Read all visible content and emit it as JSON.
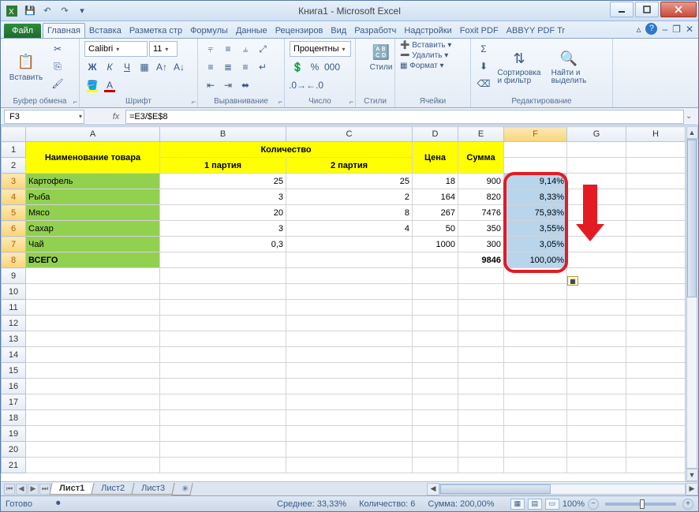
{
  "titlebar": {
    "title": "Книга1 - Microsoft Excel"
  },
  "qat": {
    "save": "💾",
    "undo": "↶",
    "redo": "↷"
  },
  "ribbon": {
    "file": "Файл",
    "tabs": [
      "Главная",
      "Вставка",
      "Разметка стр",
      "Формулы",
      "Данные",
      "Рецензиров",
      "Вид",
      "Разработч",
      "Надстройки",
      "Foxit PDF",
      "ABBYY PDF Tr"
    ],
    "groups": {
      "clipboard": {
        "label": "Буфер обмена",
        "paste": "Вставить"
      },
      "font": {
        "label": "Шрифт",
        "name": "Calibri",
        "size": "11",
        "bold": "Ж",
        "italic": "К",
        "underline": "Ч"
      },
      "align": {
        "label": "Выравнивание"
      },
      "number": {
        "label": "Число",
        "format": "Процентны"
      },
      "styles": {
        "label": "Стили",
        "btn": "Стили"
      },
      "cells": {
        "label": "Ячейки",
        "insert": "Вставить",
        "delete": "Удалить",
        "format": "Формат"
      },
      "editing": {
        "label": "Редактирование",
        "sort": "Сортировка\nи фильтр",
        "find": "Найти и\nвыделить"
      }
    }
  },
  "formula": {
    "cell": "F3",
    "value": "=E3/$E$8"
  },
  "columns": {
    "A": "A",
    "B": "B",
    "C": "C",
    "D": "D",
    "E": "E",
    "F": "F",
    "G": "G",
    "H": "H"
  },
  "table": {
    "h_name": "Наименование товара",
    "h_qty": "Количество",
    "h_p1": "1 партия",
    "h_p2": "2 партия",
    "h_price": "Цена",
    "h_sum": "Сумма",
    "rows": [
      {
        "name": "Картофель",
        "p1": "25",
        "p2": "25",
        "price": "18",
        "sum": "900",
        "pct": "9,14%"
      },
      {
        "name": "Рыба",
        "p1": "3",
        "p2": "2",
        "price": "164",
        "sum": "820",
        "pct": "8,33%"
      },
      {
        "name": "Мясо",
        "p1": "20",
        "p2": "8",
        "price": "267",
        "sum": "7476",
        "pct": "75,93%"
      },
      {
        "name": "Сахар",
        "p1": "3",
        "p2": "4",
        "price": "50",
        "sum": "350",
        "pct": "3,55%"
      },
      {
        "name": "Чай",
        "p1": "0,3",
        "p2": "",
        "price": "1000",
        "sum": "300",
        "pct": "3,05%"
      }
    ],
    "total": {
      "name": "ВСЕГО",
      "sum": "9846",
      "pct": "100,00%"
    }
  },
  "sheets": {
    "s1": "Лист1",
    "s2": "Лист2",
    "s3": "Лист3"
  },
  "status": {
    "ready": "Готово",
    "avg": "Среднее: 33,33%",
    "count": "Количество: 6",
    "sum": "Сумма: 200,00%",
    "zoom": "100%"
  }
}
